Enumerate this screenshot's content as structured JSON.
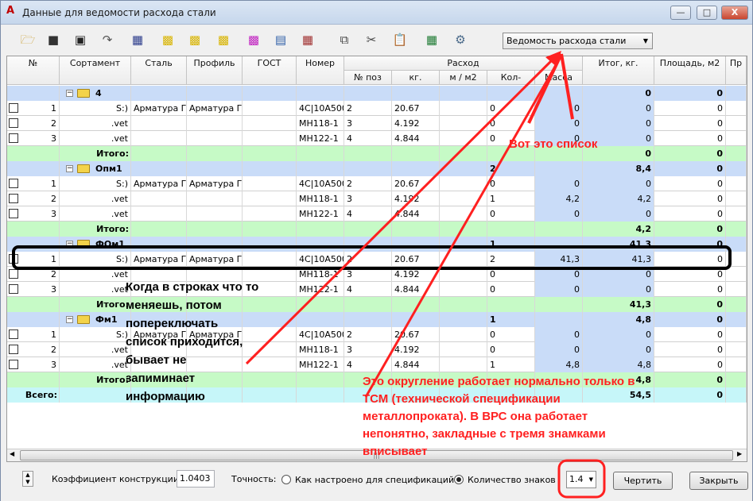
{
  "window": {
    "title": "Данные для ведомости расхода стали",
    "min": "—",
    "max": "□",
    "close": "X"
  },
  "toolbar": {
    "icons": [
      "open-folder",
      "save",
      "save-as",
      "export",
      "edit-table",
      "add-folder",
      "add-folder-green",
      "remove-folder",
      "add-item",
      "insert-row",
      "delete-row",
      "copy",
      "cut",
      "paste",
      "excel",
      "settings"
    ],
    "report_select": "Ведомость расхода стали"
  },
  "grid": {
    "headers": {
      "num": "№",
      "sortament": "Сортамент",
      "steel": "Сталь",
      "profile": "Профиль",
      "gost": "ГОСТ",
      "number": "Номер",
      "consumption": "Расход",
      "pos": "№ поз",
      "kg": "кг.",
      "m_m2": "м / м2",
      "qty": "Кол-",
      "mass": "Масса",
      "total_kg": "Итог, кг.",
      "area": "Площадь, м2",
      "more": "Пр"
    },
    "rows": [
      {
        "type": "group",
        "name": "4",
        "qty": "",
        "total": "0",
        "area": "0"
      },
      {
        "type": "item",
        "n": "1",
        "sort": "S:)",
        "steel": "Арматура Г",
        "prof": "Арматура Г",
        "num": "4C|10A500",
        "pos": "2",
        "kg": "20.67",
        "qty": "0",
        "mass": "0",
        "total": "0",
        "area": "0"
      },
      {
        "type": "item",
        "n": "2",
        "sort": ".vet",
        "steel": "",
        "prof": "",
        "num": "MH118-1",
        "pos": "3",
        "kg": "4.192",
        "qty": "0",
        "mass": "0",
        "total": "0",
        "area": "0"
      },
      {
        "type": "item",
        "n": "3",
        "sort": ".vet",
        "steel": "",
        "prof": "",
        "num": "MH122-1",
        "pos": "4",
        "kg": "4.844",
        "qty": "0",
        "mass": "0",
        "total": "0",
        "area": "0"
      },
      {
        "type": "sum",
        "label": "Итого:",
        "total": "0",
        "area": "0"
      },
      {
        "type": "group",
        "name": "Опм1",
        "qty": "2",
        "total": "8,4",
        "area": "0"
      },
      {
        "type": "item",
        "n": "1",
        "sort": "S:)",
        "steel": "Арматура Г",
        "prof": "Арматура Г",
        "num": "4C|10A500",
        "pos": "2",
        "kg": "20.67",
        "qty": "0",
        "mass": "0",
        "total": "0",
        "area": "0"
      },
      {
        "type": "item",
        "n": "2",
        "sort": ".vet",
        "steel": "",
        "prof": "",
        "num": "MH118-1",
        "pos": "3",
        "kg": "4.192",
        "qty": "1",
        "mass": "4,2",
        "total": "4,2",
        "area": "0"
      },
      {
        "type": "item",
        "n": "3",
        "sort": ".vet",
        "steel": "",
        "prof": "",
        "num": "MH122-1",
        "pos": "4",
        "kg": "4.844",
        "qty": "0",
        "mass": "0",
        "total": "0",
        "area": "0"
      },
      {
        "type": "sum",
        "label": "Итого:",
        "total": "4,2",
        "area": "0"
      },
      {
        "type": "group",
        "name": "ФОм1",
        "qty": "1",
        "total": "41,3",
        "area": "0"
      },
      {
        "type": "item",
        "n": "1",
        "sort": "S:)",
        "steel": "Арматура Г",
        "prof": "Арматура Г",
        "num": "4C|10A500",
        "pos": "2",
        "kg": "20.67",
        "qty": "2",
        "mass": "41,3",
        "total": "41,3",
        "area": "0"
      },
      {
        "type": "item",
        "n": "2",
        "sort": ".vet",
        "steel": "",
        "prof": "",
        "num": "MH118-1",
        "pos": "3",
        "kg": "4.192",
        "qty": "0",
        "mass": "0",
        "total": "0",
        "area": "0"
      },
      {
        "type": "item",
        "n": "3",
        "sort": ".vet",
        "steel": "",
        "prof": "",
        "num": "MH122-1",
        "pos": "4",
        "kg": "4.844",
        "qty": "0",
        "mass": "0",
        "total": "0",
        "area": "0"
      },
      {
        "type": "sum",
        "label": "Итого:",
        "total": "41,3",
        "area": "0"
      },
      {
        "type": "group",
        "name": "Фм1",
        "qty": "1",
        "total": "4,8",
        "area": "0"
      },
      {
        "type": "item",
        "n": "1",
        "sort": "S:)",
        "steel": "Арматура Г",
        "prof": "Арматура Г",
        "num": "4C|10A500",
        "pos": "2",
        "kg": "20.67",
        "qty": "0",
        "mass": "0",
        "total": "0",
        "area": "0"
      },
      {
        "type": "item",
        "n": "2",
        "sort": ".vet",
        "steel": "",
        "prof": "",
        "num": "MH118-1",
        "pos": "3",
        "kg": "4.192",
        "qty": "0",
        "mass": "0",
        "total": "0",
        "area": "0"
      },
      {
        "type": "item",
        "n": "3",
        "sort": ".vet",
        "steel": "",
        "prof": "",
        "num": "MH122-1",
        "pos": "4",
        "kg": "4.844",
        "qty": "1",
        "mass": "4,8",
        "total": "4,8",
        "area": "0"
      },
      {
        "type": "sum",
        "label": "Итого:",
        "total": "4,8",
        "area": "0"
      },
      {
        "type": "total",
        "label": "Всего:",
        "total": "54,5",
        "area": "0"
      }
    ],
    "scroll_grip": "|||"
  },
  "bottom": {
    "coef_label": "Коэффициент конструкции",
    "coef_value": "1.0403",
    "precision_label": "Точность:",
    "radio1": "Как настроено для спецификаций",
    "radio2": "Количество знаков",
    "digits_value": "1.4",
    "draw_button": "Чертить",
    "close_button": "Закрыть"
  },
  "annotations": {
    "list_note": "Вот это список",
    "switch_note": [
      "Когда в строках что то",
      "меняешь, потом",
      "попереключать",
      "список приходится,",
      "бывает не",
      "запиминает",
      "информацию"
    ],
    "round_note": [
      "Это округление работает нормально только в",
      "ТСМ (технической спецификации",
      "металлопроката). В ВРС она работает",
      "непонятно, закладные с тремя знамками",
      "вписывает"
    ]
  },
  "colors": {
    "group_row": "#c9dcf8",
    "sum_row": "#c6fac6",
    "total_row": "#c6f6f9",
    "annotation_red": "#ff2020"
  }
}
